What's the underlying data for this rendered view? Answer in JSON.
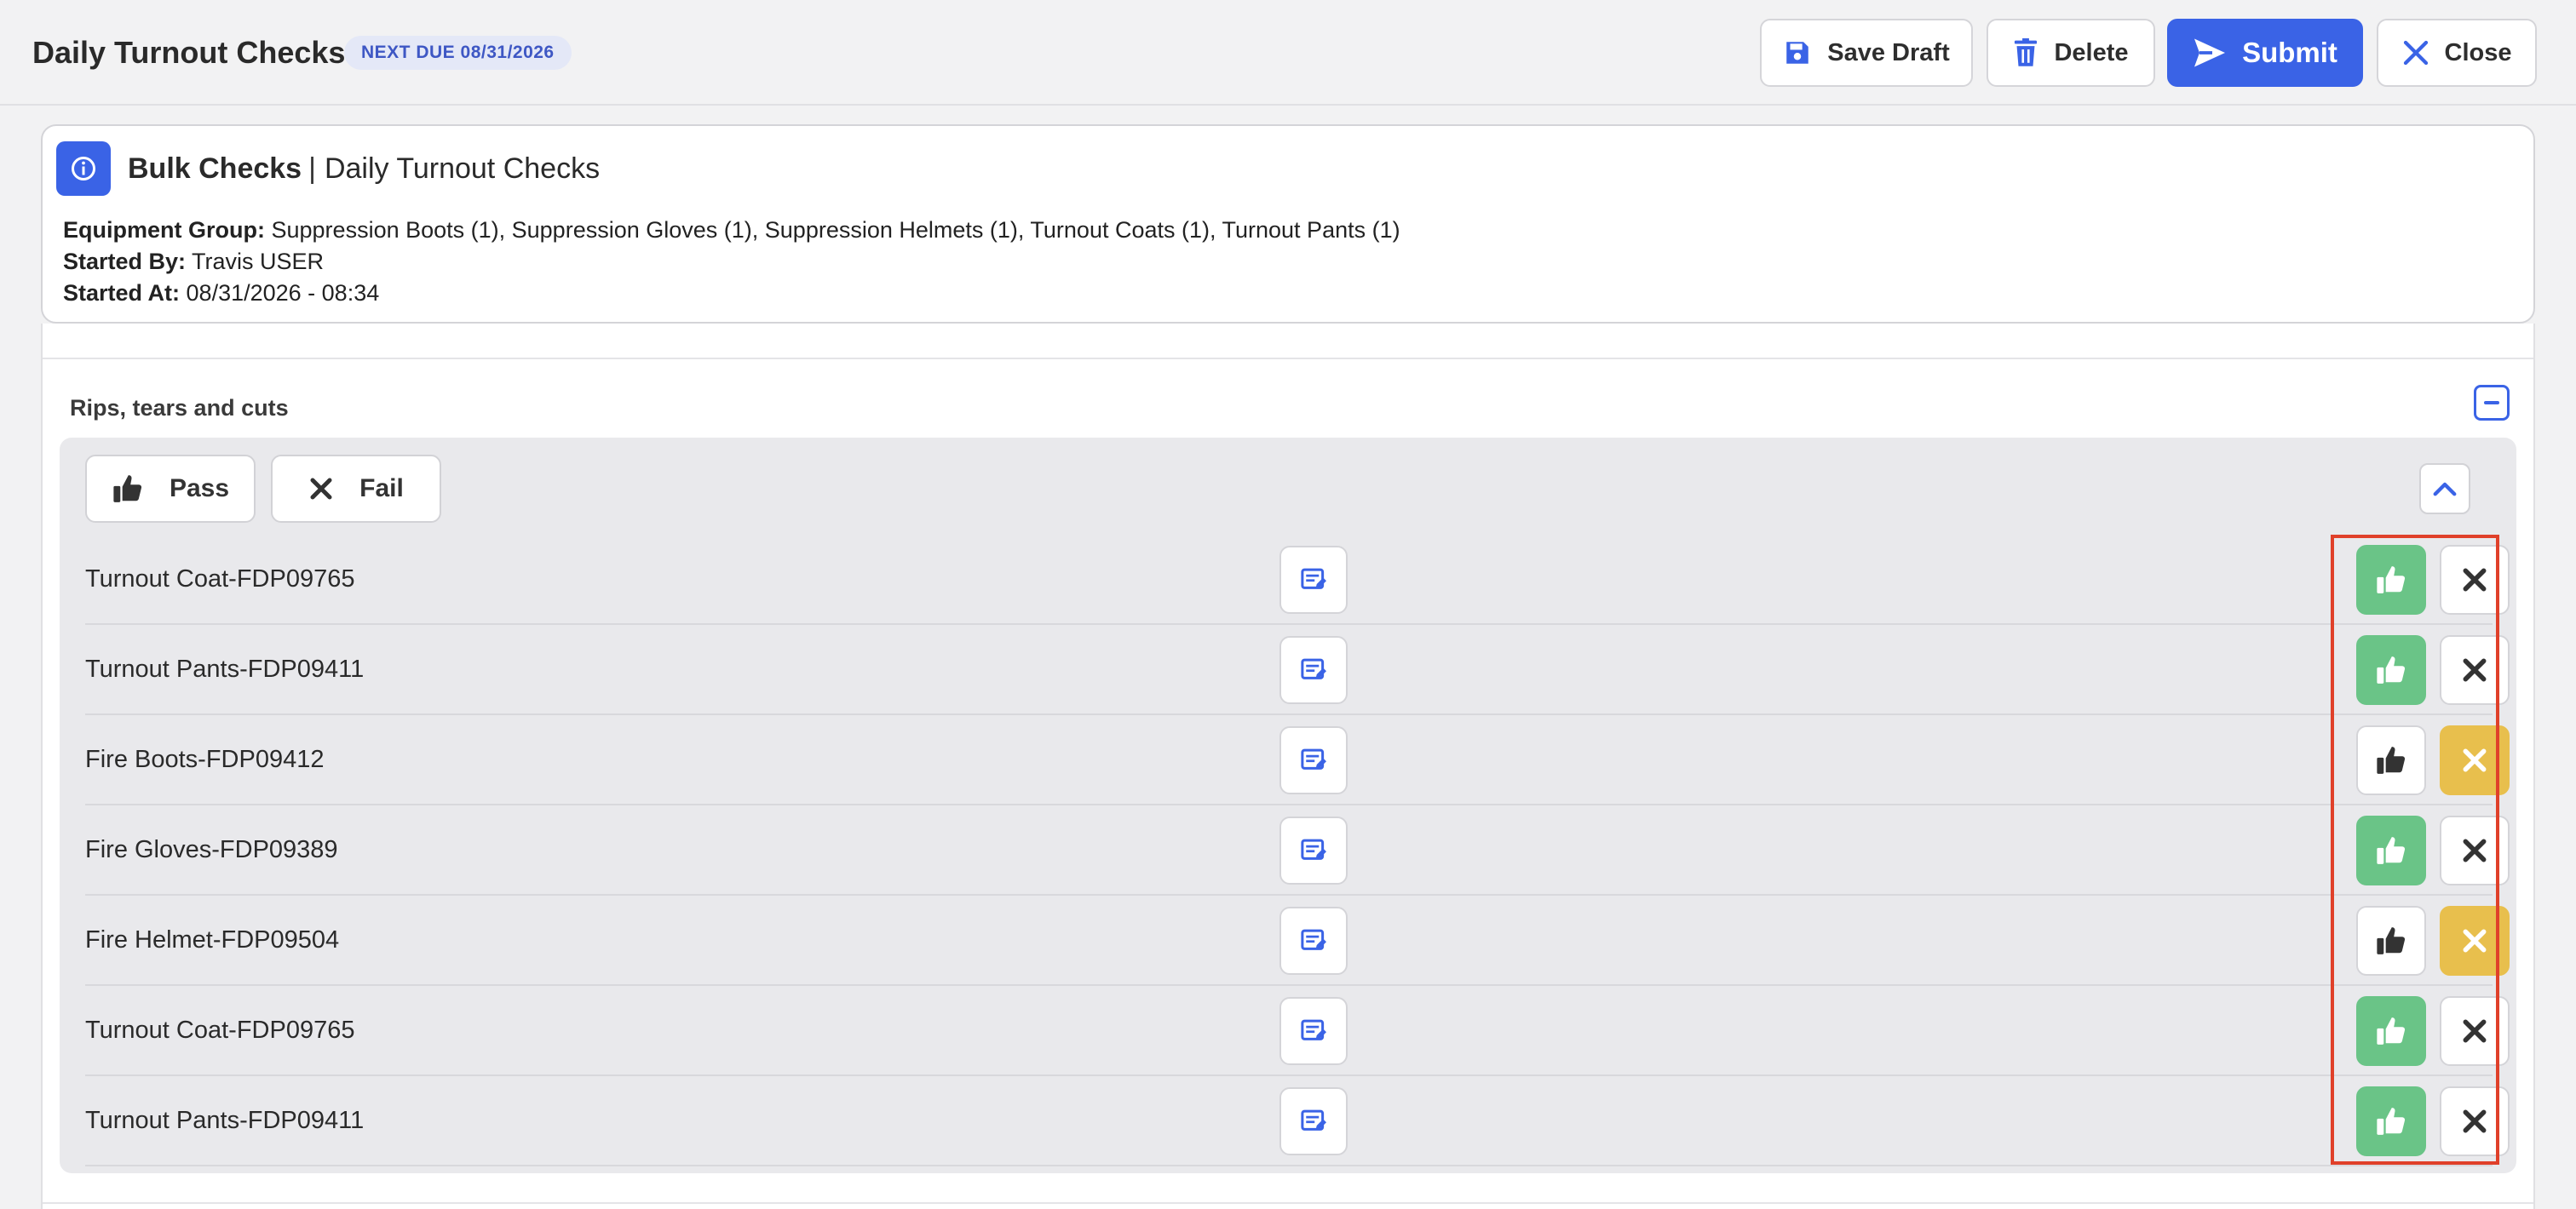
{
  "header": {
    "title": "Daily Turnout Checks",
    "next_due_badge": "NEXT DUE 08/31/2026",
    "buttons": {
      "save_draft": "Save Draft",
      "delete": "Delete",
      "submit": "Submit",
      "close": "Close"
    }
  },
  "info_card": {
    "title_bold": "Bulk Checks",
    "separator": "|",
    "title_rest": "Daily Turnout Checks",
    "equipment_group_label": "Equipment Group:",
    "equipment_group_value": "Suppression Boots (1), Suppression Gloves (1), Suppression Helmets (1), Turnout Coats (1), Turnout Pants (1)",
    "started_by_label": "Started By:",
    "started_by_value": "Travis USER",
    "started_at_label": "Started At:",
    "started_at_value": "08/31/2026 - 08:34"
  },
  "section": {
    "title": "Rips, tears and cuts",
    "bulk_pass_label": "Pass",
    "bulk_fail_label": "Fail",
    "items": [
      {
        "name": "Turnout Coat-FDP09765",
        "status": "pass"
      },
      {
        "name": "Turnout Pants-FDP09411",
        "status": "pass"
      },
      {
        "name": "Fire Boots-FDP09412",
        "status": "fail"
      },
      {
        "name": "Fire Gloves-FDP09389",
        "status": "pass"
      },
      {
        "name": "Fire Helmet-FDP09504",
        "status": "fail"
      },
      {
        "name": "Turnout Coat-FDP09765",
        "status": "pass"
      },
      {
        "name": "Turnout Pants-FDP09411",
        "status": "pass"
      }
    ]
  },
  "icons": {
    "save": "floppy-disk-icon",
    "delete": "trash-icon",
    "submit": "send-icon",
    "close": "x-icon",
    "info": "info-circle-icon",
    "collapse": "minus-square-icon",
    "chevron": "chevron-up-icon",
    "note": "note-edit-icon",
    "pass": "thumbs-up-icon",
    "fail": "x-icon"
  },
  "colors": {
    "primary": "#3a63e6",
    "pass_active": "#6ac487",
    "fail_active": "#e8bf4d",
    "highlight": "#e0402a",
    "badge_bg": "#e4e8f7"
  }
}
